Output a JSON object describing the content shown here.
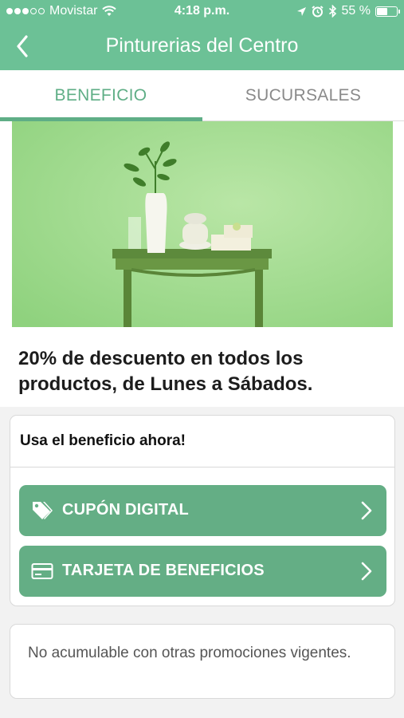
{
  "status_bar": {
    "carrier": "Movistar",
    "signal_bars_filled": 3,
    "signal_bars_total": 5,
    "time": "4:18 p.m.",
    "battery_percent_text": "55 %",
    "battery_level": 0.55
  },
  "nav": {
    "title": "Pinturerias del Centro"
  },
  "tabs": [
    {
      "label": "BENEFICIO",
      "active": true
    },
    {
      "label": "SUCURSALES",
      "active": false
    }
  ],
  "offer": {
    "text": "20% de descuento en todos los productos, de Lunes a Sábados."
  },
  "benefit_card": {
    "header": "Usa el beneficio ahora!",
    "buttons": [
      {
        "label": "CUPÓN DIGITAL",
        "icon": "tag-icon"
      },
      {
        "label": "TARJETA DE BENEFICIOS",
        "icon": "credit-card-icon"
      }
    ]
  },
  "note": {
    "text": "No acumulable con otras promociones vigentes."
  },
  "colors": {
    "brand_green": "#6cc196",
    "button_green": "#64ae85",
    "tab_active": "#5fae86"
  }
}
